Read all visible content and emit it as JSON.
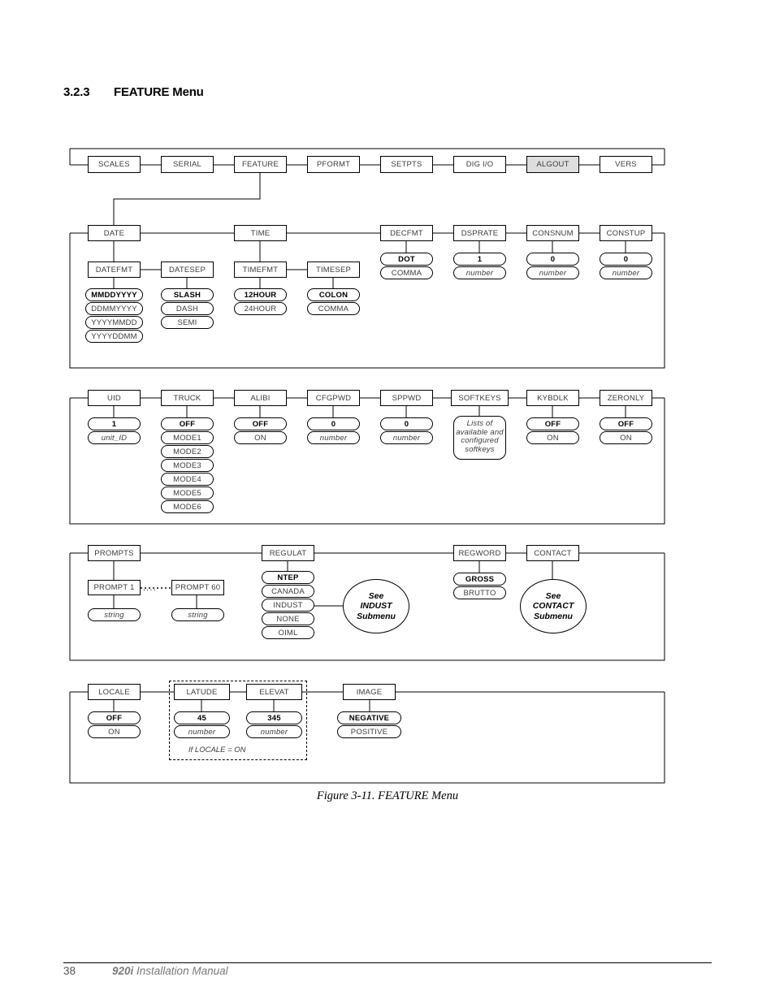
{
  "heading": {
    "number": "3.2.3",
    "title": "FEATURE Menu"
  },
  "caption": "Figure 3-11. FEATURE Menu",
  "footer": {
    "page": "38",
    "manual_bold": "920i",
    "manual_rest": " Installation Manual"
  },
  "colors": {
    "shaded_box": "#dedede",
    "line": "#000000",
    "text": "#3c3c3c"
  },
  "diagram": {
    "top_level_menus": [
      {
        "label": "SCALES",
        "shaded": false
      },
      {
        "label": "SERIAL",
        "shaded": false
      },
      {
        "label": "FEATURE",
        "shaded": false
      },
      {
        "label": "PFORMT",
        "shaded": false
      },
      {
        "label": "SETPTS",
        "shaded": false
      },
      {
        "label": "DIG I/O",
        "shaded": false
      },
      {
        "label": "ALGOUT",
        "shaded": true
      },
      {
        "label": "VERS",
        "shaded": false
      }
    ],
    "row2": [
      {
        "label": "DATE"
      },
      {
        "label": "TIME"
      },
      {
        "label": "DECFMT",
        "values": [
          {
            "text": "DOT",
            "style": "bold"
          },
          {
            "text": "COMMA",
            "style": "plain"
          }
        ]
      },
      {
        "label": "DSPRATE",
        "values": [
          {
            "text": "1",
            "style": "bold"
          },
          {
            "text": "number",
            "style": "italic"
          }
        ]
      },
      {
        "label": "CONSNUM",
        "values": [
          {
            "text": "0",
            "style": "bold"
          },
          {
            "text": "number",
            "style": "italic"
          }
        ]
      },
      {
        "label": "CONSTUP",
        "values": [
          {
            "text": "0",
            "style": "bold"
          },
          {
            "text": "number",
            "style": "italic"
          }
        ]
      }
    ],
    "row2_sub": [
      {
        "label": "DATEFMT",
        "values": [
          {
            "text": "MMDDYYYY",
            "style": "bold"
          },
          {
            "text": "DDMMYYYY",
            "style": "plain"
          },
          {
            "text": "YYYYMMDD",
            "style": "plain"
          },
          {
            "text": "YYYYDDMM",
            "style": "plain"
          }
        ]
      },
      {
        "label": "DATESEP",
        "values": [
          {
            "text": "SLASH",
            "style": "bold"
          },
          {
            "text": "DASH",
            "style": "plain"
          },
          {
            "text": "SEMI",
            "style": "plain"
          }
        ]
      },
      {
        "label": "TIMEFMT",
        "values": [
          {
            "text": "12HOUR",
            "style": "bold"
          },
          {
            "text": "24HOUR",
            "style": "plain"
          }
        ]
      },
      {
        "label": "TIMESEP",
        "values": [
          {
            "text": "COLON",
            "style": "bold"
          },
          {
            "text": "COMMA",
            "style": "plain"
          }
        ]
      }
    ],
    "row3": [
      {
        "label": "UID",
        "values": [
          {
            "text": "1",
            "style": "bold"
          },
          {
            "text": "unit_ID",
            "style": "italic"
          }
        ]
      },
      {
        "label": "TRUCK",
        "values": [
          {
            "text": "OFF",
            "style": "bold"
          },
          {
            "text": "MODE1",
            "style": "plain"
          },
          {
            "text": "MODE2",
            "style": "plain"
          },
          {
            "text": "MODE3",
            "style": "plain"
          },
          {
            "text": "MODE4",
            "style": "plain"
          },
          {
            "text": "MODE5",
            "style": "plain"
          },
          {
            "text": "MODE6",
            "style": "plain"
          }
        ]
      },
      {
        "label": "ALIBI",
        "values": [
          {
            "text": "OFF",
            "style": "bold"
          },
          {
            "text": "ON",
            "style": "plain"
          }
        ]
      },
      {
        "label": "CFGPWD",
        "values": [
          {
            "text": "0",
            "style": "bold"
          },
          {
            "text": "number",
            "style": "italic"
          }
        ]
      },
      {
        "label": "SPPWD",
        "values": [
          {
            "text": "0",
            "style": "bold"
          },
          {
            "text": "number",
            "style": "italic"
          }
        ]
      },
      {
        "label": "SOFTKEYS",
        "note": "Lists of\navailable and\nconfigured\nsoftkeys"
      },
      {
        "label": "KYBDLK",
        "values": [
          {
            "text": "OFF",
            "style": "bold"
          },
          {
            "text": "ON",
            "style": "plain"
          }
        ]
      },
      {
        "label": "ZERONLY",
        "values": [
          {
            "text": "OFF",
            "style": "bold"
          },
          {
            "text": "ON",
            "style": "plain"
          }
        ]
      }
    ],
    "row4": [
      {
        "label": "PROMPTS"
      },
      {
        "label": "REGULAT",
        "values": [
          {
            "text": "NTEP",
            "style": "bold"
          },
          {
            "text": "CANADA",
            "style": "plain"
          },
          {
            "text": "INDUST",
            "style": "plain"
          },
          {
            "text": "NONE",
            "style": "plain"
          },
          {
            "text": "OIML",
            "style": "plain"
          }
        ]
      },
      {
        "label": "REGWORD",
        "values": [
          {
            "text": "GROSS",
            "style": "bold"
          },
          {
            "text": "BRUTTO",
            "style": "plain"
          }
        ]
      },
      {
        "label": "CONTACT"
      }
    ],
    "prompt_nodes": [
      {
        "label": "PROMPT 1",
        "value": "string"
      },
      {
        "label": "PROMPT 60",
        "value": "string"
      }
    ],
    "prompt_ellipsis": "....",
    "ellipses": [
      {
        "line1": "See",
        "line2": "INDUST",
        "line3": "Submenu"
      },
      {
        "line1": "See",
        "line2": "CONTACT",
        "line3": "Submenu"
      }
    ],
    "row5": [
      {
        "label": "LOCALE",
        "values": [
          {
            "text": "OFF",
            "style": "bold"
          },
          {
            "text": "ON",
            "style": "plain"
          }
        ]
      },
      {
        "label": "LATUDE",
        "values": [
          {
            "text": "45",
            "style": "bold"
          },
          {
            "text": "number",
            "style": "italic"
          }
        ]
      },
      {
        "label": "ELEVAT",
        "values": [
          {
            "text": "345",
            "style": "bold"
          },
          {
            "text": "number",
            "style": "italic"
          }
        ]
      },
      {
        "label": "IMAGE",
        "values": [
          {
            "text": "NEGATIVE",
            "style": "bold"
          },
          {
            "text": "POSITIVE",
            "style": "plain"
          }
        ]
      }
    ],
    "conditional_note": "If LOCALE = ON"
  }
}
